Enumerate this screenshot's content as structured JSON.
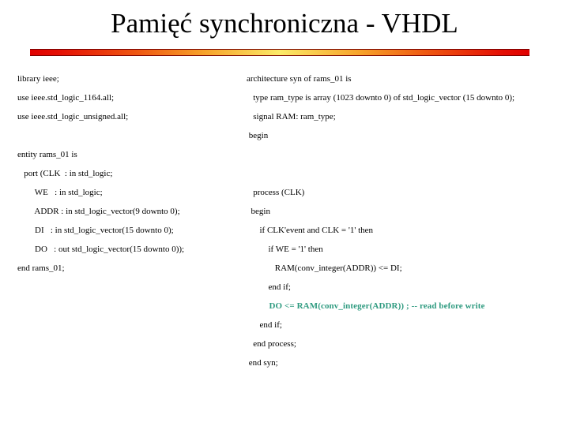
{
  "slide": {
    "title": "Pamięć synchroniczna - VHDL",
    "accent_color": "#2f9b80",
    "divider_colors": [
      "#e00000",
      "#ef5a12",
      "#fbea68",
      "#ef5a12",
      "#e00000"
    ]
  },
  "left_column": {
    "lines": [
      {
        "text": "library ieee;",
        "indent": 0,
        "accent": false
      },
      {
        "text": "use ieee.std_logic_1164.all;",
        "indent": 0,
        "accent": false
      },
      {
        "text": "use ieee.std_logic_unsigned.all;",
        "indent": 0,
        "accent": false
      },
      {
        "text": "",
        "indent": 0,
        "accent": false
      },
      {
        "text": "entity rams_01 is",
        "indent": 0,
        "accent": false
      },
      {
        "text": "   port (CLK  : in std_logic;",
        "indent": 0,
        "accent": false
      },
      {
        "text": "        WE   : in std_logic;",
        "indent": 0,
        "accent": false
      },
      {
        "text": "        ADDR : in std_logic_vector(9 downto 0);",
        "indent": 0,
        "accent": false
      },
      {
        "text": "        DI   : in std_logic_vector(15 downto 0);",
        "indent": 0,
        "accent": false
      },
      {
        "text": "        DO   : out std_logic_vector(15 downto 0));",
        "indent": 0,
        "accent": false
      },
      {
        "text": "end rams_01;",
        "indent": 0,
        "accent": false
      }
    ]
  },
  "right_column": {
    "lines": [
      {
        "text": "architecture syn of rams_01 is",
        "indent": 0,
        "accent": false
      },
      {
        "text": "   type ram_type is array (1023 downto 0) of std_logic_vector (15 downto 0);",
        "indent": 0,
        "accent": false
      },
      {
        "text": "   signal RAM: ram_type;",
        "indent": 0,
        "accent": false
      },
      {
        "text": " begin",
        "indent": 0,
        "accent": false
      },
      {
        "text": "",
        "indent": 0,
        "accent": false
      },
      {
        "text": "",
        "indent": 0,
        "accent": false
      },
      {
        "text": "   process (CLK)",
        "indent": 0,
        "accent": false
      },
      {
        "text": "  begin",
        "indent": 0,
        "accent": false
      },
      {
        "text": "      if CLK'event and CLK = '1' then",
        "indent": 0,
        "accent": false
      },
      {
        "text": "          if WE = '1' then",
        "indent": 0,
        "accent": false
      },
      {
        "text": "             RAM(conv_integer(ADDR)) <= DI;",
        "indent": 0,
        "accent": false
      },
      {
        "text": "          end if;",
        "indent": 0,
        "accent": false
      },
      {
        "text": "          DO <= RAM(conv_integer(ADDR)) ; -- read before write",
        "indent": 0,
        "accent": true
      },
      {
        "text": "      end if;",
        "indent": 0,
        "accent": false
      },
      {
        "text": "   end process;",
        "indent": 0,
        "accent": false
      },
      {
        "text": " end syn;",
        "indent": 0,
        "accent": false
      }
    ]
  }
}
